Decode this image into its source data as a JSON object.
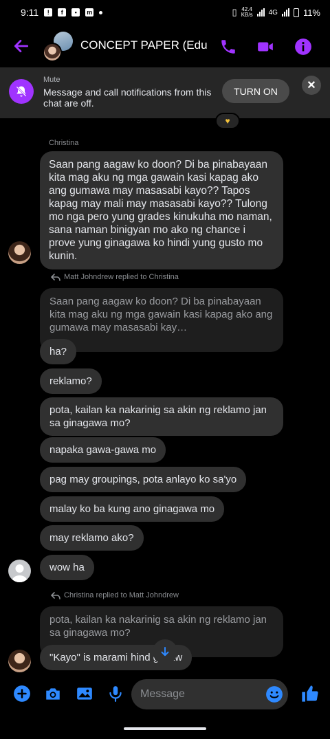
{
  "status_bar": {
    "time": "9:11",
    "net_speed_value": "42.4",
    "net_speed_unit": "KB/s",
    "network": "4G",
    "battery": "11%"
  },
  "header": {
    "title": "CONCEPT PAPER (Edu…",
    "accent_color": "#a033ff"
  },
  "mute_banner": {
    "label": "Mute",
    "text": "Message and call notifications from this chat are off.",
    "button_label": "TURN ON"
  },
  "messages": {
    "m1_sender": "Christina",
    "m1_text": "Saan pang aagaw ko doon? Di ba pinabayaan kita mag aku ng mga gawain kasi kapag ako ang gumawa may masasabi kayo?? Tapos kapag may mali may masasabi kayo?? Tulong mo nga pero yung grades kinukuha mo naman, sana naman binigyan mo ako ng chance i prove yung ginagawa ko hindi yung gusto mo kunin.",
    "reply1_label": "Matt Johndrew replied to Christina",
    "reply1_quote": "Saan pang aagaw ko doon? Di ba pinabayaan kita mag aku ng mga gawain kasi kapag ako ang gumawa may masasabi kay…",
    "g1": "ha?",
    "g2": "reklamo?",
    "g3": "pota, kailan ka nakarinig sa akin ng reklamo jan sa ginagawa mo?",
    "g4": "napaka gawa-gawa mo",
    "g5": "pag may groupings, pota anlayo ko sa'yo",
    "g6": "malay ko ba kung ano ginagawa mo",
    "g7": "may reklamo ako?",
    "g8": "wow ha",
    "reply2_label": "Christina replied to Matt Johndrew",
    "reply2_quote": "pota, kailan ka nakarinig sa akin ng reklamo jan sa ginagawa mo?",
    "last": "\"Kayo\" is marami hind  g ikaw"
  },
  "composer": {
    "placeholder": "Message"
  }
}
